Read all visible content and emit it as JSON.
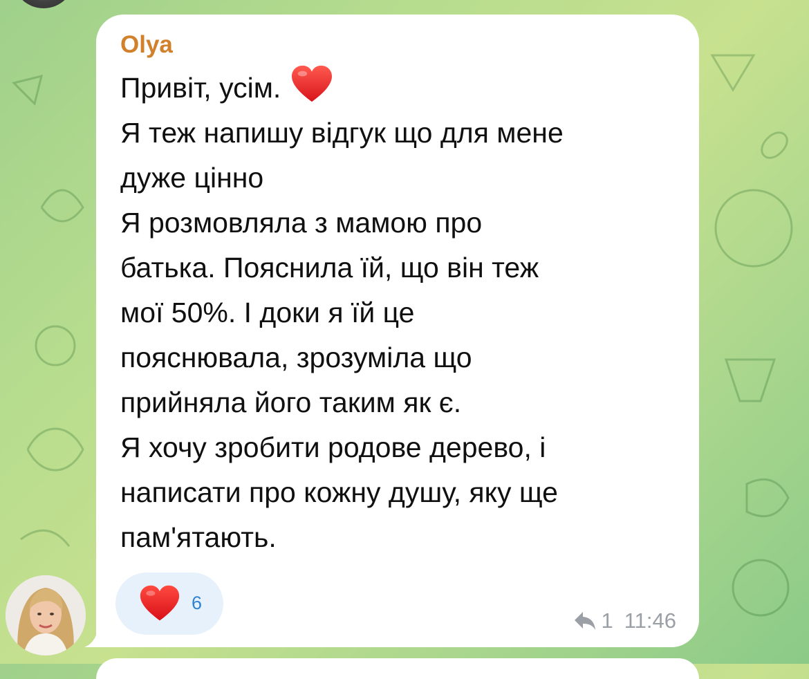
{
  "chat": {
    "message": {
      "sender": "Olya",
      "lines": [
        "Привіт, усім.",
        "Я теж напишу відгук що для мене",
        "дуже цінно",
        "Я розмовляла з мамою про",
        "батька. Пояснила їй, що він теж",
        "мої 50%. І доки я їй це",
        "пояснювала, зрозуміла що",
        "прийняла його таким як є.",
        "Я хочу зробити родове дерево, і",
        "написати про кожну душу, яку ще",
        "пам'ятають."
      ],
      "inline_icon": "red-heart-emoji",
      "reaction": {
        "icon": "red-heart-icon",
        "count": "6"
      },
      "reply_count": "1",
      "time": "11:46"
    }
  },
  "colors": {
    "sender": "#d1802c",
    "reaction_bg": "#e7f1fb",
    "reaction_count": "#2f83d2",
    "meta": "#9aa0a6",
    "heart": "#e8201f",
    "wallpaper_start": "#9fd08b",
    "wallpaper_end": "#8bca88"
  },
  "icons": {
    "reply": "reply-arrow-icon",
    "avatar": "user-avatar"
  }
}
